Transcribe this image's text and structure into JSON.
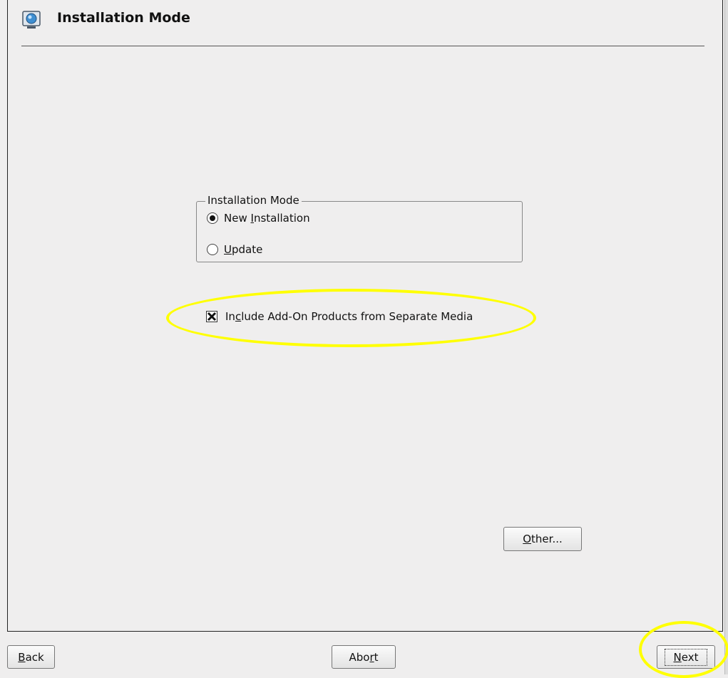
{
  "header": {
    "title": "Installation Mode",
    "icon": "installer-icon"
  },
  "mode_group": {
    "legend": "Installation Mode",
    "options": [
      {
        "pre": "New ",
        "key": "I",
        "post": "nstallation",
        "selected": true
      },
      {
        "pre": "",
        "key": "U",
        "post": "pdate",
        "selected": false
      }
    ]
  },
  "addon": {
    "pre": "In",
    "key": "c",
    "post": "lude Add-On Products from Separate Media",
    "checked": true
  },
  "buttons": {
    "other": {
      "pre": "",
      "key": "O",
      "post": "ther..."
    },
    "back": {
      "pre": "",
      "key": "B",
      "post": "ack"
    },
    "abort": {
      "pre": "Abo",
      "key": "r",
      "post": "t"
    },
    "next": {
      "pre": "",
      "key": "N",
      "post": "ext"
    }
  },
  "highlight_color": "#ffff00"
}
